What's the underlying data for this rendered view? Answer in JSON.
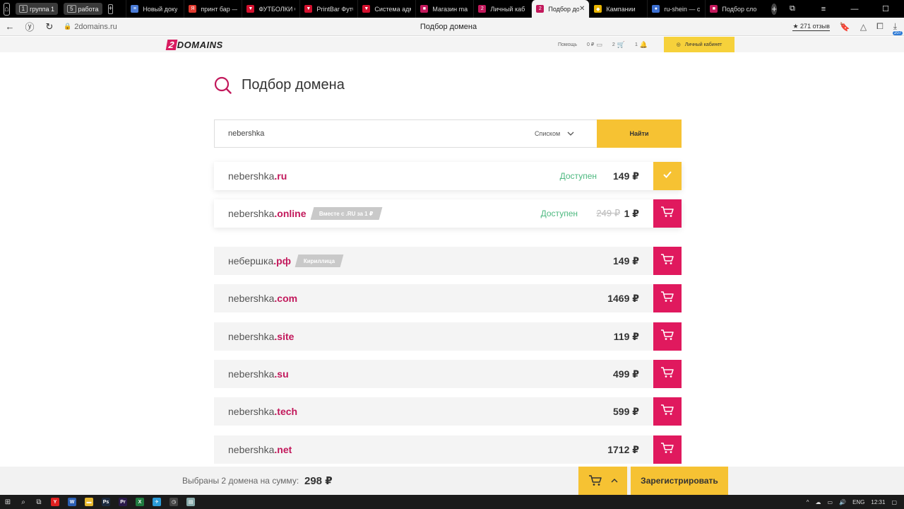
{
  "browser": {
    "tab_groups": [
      {
        "num": "1",
        "label": "группа 1"
      },
      {
        "num": "5",
        "label": "работа"
      }
    ],
    "tabs": [
      {
        "title": "Новый доку",
        "color": "#4a7bd6",
        "glyph": "≡"
      },
      {
        "title": "принт бар —",
        "color": "#e03a2f",
        "glyph": "Я"
      },
      {
        "title": "ФУТБОЛКИ С",
        "color": "#d3102e",
        "glyph": "▼"
      },
      {
        "title": "PrintBar Футб",
        "color": "#d3102e",
        "glyph": "▼"
      },
      {
        "title": "Система адм",
        "color": "#d3102e",
        "glyph": "▼"
      },
      {
        "title": "Магазин ma",
        "color": "#c2185b",
        "glyph": "■"
      },
      {
        "title": "Личный каб",
        "color": "#c2185b",
        "glyph": "2"
      },
      {
        "title": "Подбор до",
        "color": "#c2185b",
        "glyph": "2",
        "active": true
      },
      {
        "title": "Кампании",
        "color": "#e8b400",
        "glyph": "◆"
      },
      {
        "title": "ru-shein — с",
        "color": "#3b6fd1",
        "glyph": "●"
      },
      {
        "title": "Подбор сло",
        "color": "#c2185b",
        "glyph": "■"
      }
    ],
    "url": "2domains.ru",
    "page_title": "Подбор домена",
    "reviews": "★ 271 отзыв",
    "downloads_badge": "207"
  },
  "site": {
    "logo_digit": "2",
    "logo_text": "DOMAINS",
    "help": "Помощь",
    "balance": "0 ₽",
    "cart_count": "2",
    "notifications": "1",
    "cabinet": "Личный кабинет"
  },
  "page": {
    "heading": "Подбор домена",
    "search": {
      "value": "nebershka",
      "view_mode": "Списком",
      "find_label": "Найти"
    },
    "results": [
      {
        "name": "nebershka",
        "zone": ".ru",
        "status": "Доступен",
        "price": "149 ₽",
        "selected": true
      },
      {
        "name": "nebershka",
        "zone": ".online",
        "tag": "Вместе с .RU за 1 ₽",
        "status": "Доступен",
        "old_price": "249 ₽",
        "price": "1 ₽",
        "selected": false
      },
      {
        "name": "небершка",
        "zone": ".рф",
        "tag": "Кириллица",
        "price": "149 ₽",
        "selected": false
      },
      {
        "name": "nebershka",
        "zone": ".com",
        "price": "1469 ₽",
        "selected": false
      },
      {
        "name": "nebershka",
        "zone": ".site",
        "price": "119 ₽",
        "selected": false
      },
      {
        "name": "nebershka",
        "zone": ".su",
        "price": "499 ₽",
        "selected": false
      },
      {
        "name": "nebershka",
        "zone": ".tech",
        "price": "599 ₽",
        "selected": false
      },
      {
        "name": "nebershka",
        "zone": ".net",
        "price": "1712 ₽",
        "selected": false
      }
    ]
  },
  "bottom": {
    "summary_label": "Выбраны 2 домена на сумму:",
    "total": "298 ₽",
    "register": "Зарегистрировать"
  },
  "taskbar": {
    "lang": "ENG",
    "time": "12:31"
  },
  "colors": {
    "accent_yellow": "#f6c233",
    "accent_pink": "#e0195e",
    "zone_pink": "#c2185b",
    "available_green": "#4cb87f"
  }
}
